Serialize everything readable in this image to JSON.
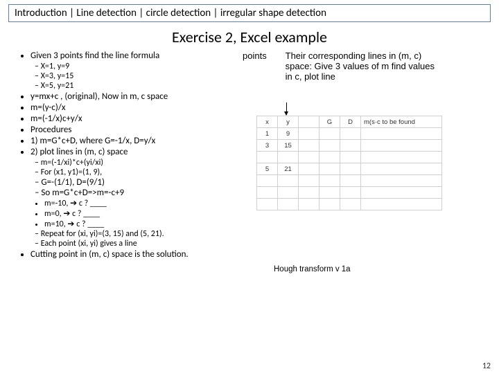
{
  "breadcrumb": "Introduction | Line detection | circle detection | irregular shape detection",
  "title": "Exercise 2, Excel example",
  "bullets": {
    "b1": "Given 3 points find the line formula",
    "b1s": [
      "X=1, y=9",
      "X=3, y=15",
      "X=5, y=21"
    ],
    "b2": "y=mx+c , (original), Now in m, c space",
    "b3": "m=(y-c)/x",
    "b4": "m=(-1/x)c+y/x",
    "b5": "Procedures",
    "b6": "1) m=G*c+D, where G=-1/x, D=y/x",
    "b7": "2) plot lines in (m, c) space",
    "b7s1": [
      "m=(-1/xi)*c+(yi/xi)",
      "For (x1, y1)=(1, 9),"
    ],
    "b7s2": [
      "G=-(1/1), D=(9/1)",
      "So m=G*c+D=>m=-c+9"
    ],
    "b7s3": [
      "m=-10, ➔ c ? ____",
      "m=0, ➔ c ? ____",
      "m=10, ➔ c ? ____"
    ],
    "b7s4": [
      "Repeat for (xi, yi)=(3, 15) and (5, 21).",
      "Each point (xi, yi) gives a line"
    ],
    "b8": "Cutting point in (m, c) space is the solution."
  },
  "right": {
    "points_label": "points",
    "text": "Their corresponding lines in (m, c) space: Give 3 values of m find values in c, plot line"
  },
  "sheet": {
    "headers": [
      "x",
      "y",
      "",
      "G",
      "D",
      "m(s·c to be found"
    ],
    "rows": [
      [
        "1",
        "9",
        "",
        "",
        "",
        ""
      ],
      [
        "3",
        "15",
        "",
        "",
        "",
        ""
      ],
      [
        "",
        "",
        "",
        "",
        "",
        ""
      ],
      [
        "5",
        "21",
        "",
        "",
        "",
        ""
      ],
      [
        "",
        "",
        "",
        "",
        "",
        ""
      ],
      [
        "",
        "",
        "",
        "",
        "",
        ""
      ],
      [
        "",
        "",
        "",
        "",
        "",
        ""
      ]
    ]
  },
  "caption": "Hough  transform v 1a",
  "pagenum": "12"
}
